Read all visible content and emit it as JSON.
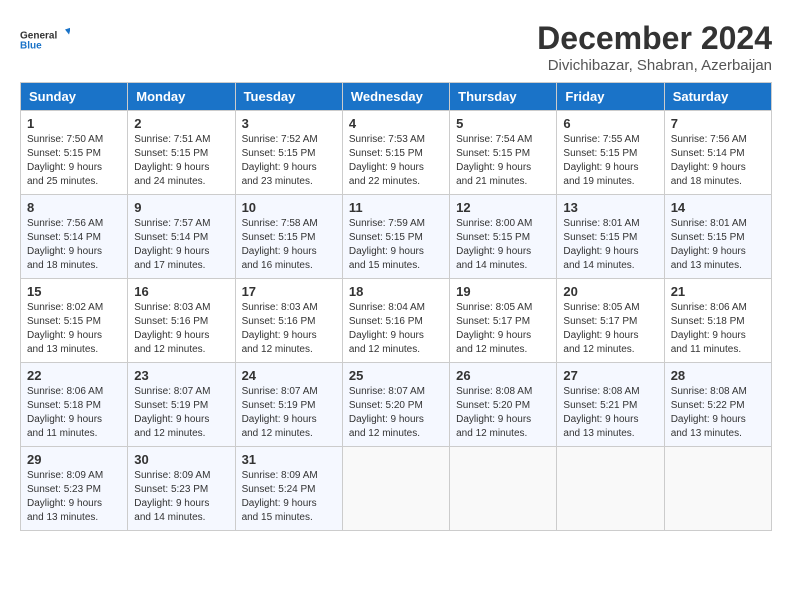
{
  "header": {
    "logo_line1": "General",
    "logo_line2": "Blue",
    "month_year": "December 2024",
    "location": "Divichibazar, Shabran, Azerbaijan"
  },
  "weekdays": [
    "Sunday",
    "Monday",
    "Tuesday",
    "Wednesday",
    "Thursday",
    "Friday",
    "Saturday"
  ],
  "weeks": [
    [
      {
        "day": "1",
        "sunrise": "Sunrise: 7:50 AM",
        "sunset": "Sunset: 5:15 PM",
        "daylight": "Daylight: 9 hours and 25 minutes."
      },
      {
        "day": "2",
        "sunrise": "Sunrise: 7:51 AM",
        "sunset": "Sunset: 5:15 PM",
        "daylight": "Daylight: 9 hours and 24 minutes."
      },
      {
        "day": "3",
        "sunrise": "Sunrise: 7:52 AM",
        "sunset": "Sunset: 5:15 PM",
        "daylight": "Daylight: 9 hours and 23 minutes."
      },
      {
        "day": "4",
        "sunrise": "Sunrise: 7:53 AM",
        "sunset": "Sunset: 5:15 PM",
        "daylight": "Daylight: 9 hours and 22 minutes."
      },
      {
        "day": "5",
        "sunrise": "Sunrise: 7:54 AM",
        "sunset": "Sunset: 5:15 PM",
        "daylight": "Daylight: 9 hours and 21 minutes."
      },
      {
        "day": "6",
        "sunrise": "Sunrise: 7:55 AM",
        "sunset": "Sunset: 5:15 PM",
        "daylight": "Daylight: 9 hours and 19 minutes."
      },
      {
        "day": "7",
        "sunrise": "Sunrise: 7:56 AM",
        "sunset": "Sunset: 5:14 PM",
        "daylight": "Daylight: 9 hours and 18 minutes."
      }
    ],
    [
      {
        "day": "8",
        "sunrise": "Sunrise: 7:56 AM",
        "sunset": "Sunset: 5:14 PM",
        "daylight": "Daylight: 9 hours and 18 minutes."
      },
      {
        "day": "9",
        "sunrise": "Sunrise: 7:57 AM",
        "sunset": "Sunset: 5:14 PM",
        "daylight": "Daylight: 9 hours and 17 minutes."
      },
      {
        "day": "10",
        "sunrise": "Sunrise: 7:58 AM",
        "sunset": "Sunset: 5:15 PM",
        "daylight": "Daylight: 9 hours and 16 minutes."
      },
      {
        "day": "11",
        "sunrise": "Sunrise: 7:59 AM",
        "sunset": "Sunset: 5:15 PM",
        "daylight": "Daylight: 9 hours and 15 minutes."
      },
      {
        "day": "12",
        "sunrise": "Sunrise: 8:00 AM",
        "sunset": "Sunset: 5:15 PM",
        "daylight": "Daylight: 9 hours and 14 minutes."
      },
      {
        "day": "13",
        "sunrise": "Sunrise: 8:01 AM",
        "sunset": "Sunset: 5:15 PM",
        "daylight": "Daylight: 9 hours and 14 minutes."
      },
      {
        "day": "14",
        "sunrise": "Sunrise: 8:01 AM",
        "sunset": "Sunset: 5:15 PM",
        "daylight": "Daylight: 9 hours and 13 minutes."
      }
    ],
    [
      {
        "day": "15",
        "sunrise": "Sunrise: 8:02 AM",
        "sunset": "Sunset: 5:15 PM",
        "daylight": "Daylight: 9 hours and 13 minutes."
      },
      {
        "day": "16",
        "sunrise": "Sunrise: 8:03 AM",
        "sunset": "Sunset: 5:16 PM",
        "daylight": "Daylight: 9 hours and 12 minutes."
      },
      {
        "day": "17",
        "sunrise": "Sunrise: 8:03 AM",
        "sunset": "Sunset: 5:16 PM",
        "daylight": "Daylight: 9 hours and 12 minutes."
      },
      {
        "day": "18",
        "sunrise": "Sunrise: 8:04 AM",
        "sunset": "Sunset: 5:16 PM",
        "daylight": "Daylight: 9 hours and 12 minutes."
      },
      {
        "day": "19",
        "sunrise": "Sunrise: 8:05 AM",
        "sunset": "Sunset: 5:17 PM",
        "daylight": "Daylight: 9 hours and 12 minutes."
      },
      {
        "day": "20",
        "sunrise": "Sunrise: 8:05 AM",
        "sunset": "Sunset: 5:17 PM",
        "daylight": "Daylight: 9 hours and 12 minutes."
      },
      {
        "day": "21",
        "sunrise": "Sunrise: 8:06 AM",
        "sunset": "Sunset: 5:18 PM",
        "daylight": "Daylight: 9 hours and 11 minutes."
      }
    ],
    [
      {
        "day": "22",
        "sunrise": "Sunrise: 8:06 AM",
        "sunset": "Sunset: 5:18 PM",
        "daylight": "Daylight: 9 hours and 11 minutes."
      },
      {
        "day": "23",
        "sunrise": "Sunrise: 8:07 AM",
        "sunset": "Sunset: 5:19 PM",
        "daylight": "Daylight: 9 hours and 12 minutes."
      },
      {
        "day": "24",
        "sunrise": "Sunrise: 8:07 AM",
        "sunset": "Sunset: 5:19 PM",
        "daylight": "Daylight: 9 hours and 12 minutes."
      },
      {
        "day": "25",
        "sunrise": "Sunrise: 8:07 AM",
        "sunset": "Sunset: 5:20 PM",
        "daylight": "Daylight: 9 hours and 12 minutes."
      },
      {
        "day": "26",
        "sunrise": "Sunrise: 8:08 AM",
        "sunset": "Sunset: 5:20 PM",
        "daylight": "Daylight: 9 hours and 12 minutes."
      },
      {
        "day": "27",
        "sunrise": "Sunrise: 8:08 AM",
        "sunset": "Sunset: 5:21 PM",
        "daylight": "Daylight: 9 hours and 13 minutes."
      },
      {
        "day": "28",
        "sunrise": "Sunrise: 8:08 AM",
        "sunset": "Sunset: 5:22 PM",
        "daylight": "Daylight: 9 hours and 13 minutes."
      }
    ],
    [
      {
        "day": "29",
        "sunrise": "Sunrise: 8:09 AM",
        "sunset": "Sunset: 5:23 PM",
        "daylight": "Daylight: 9 hours and 13 minutes."
      },
      {
        "day": "30",
        "sunrise": "Sunrise: 8:09 AM",
        "sunset": "Sunset: 5:23 PM",
        "daylight": "Daylight: 9 hours and 14 minutes."
      },
      {
        "day": "31",
        "sunrise": "Sunrise: 8:09 AM",
        "sunset": "Sunset: 5:24 PM",
        "daylight": "Daylight: 9 hours and 15 minutes."
      },
      null,
      null,
      null,
      null
    ]
  ]
}
